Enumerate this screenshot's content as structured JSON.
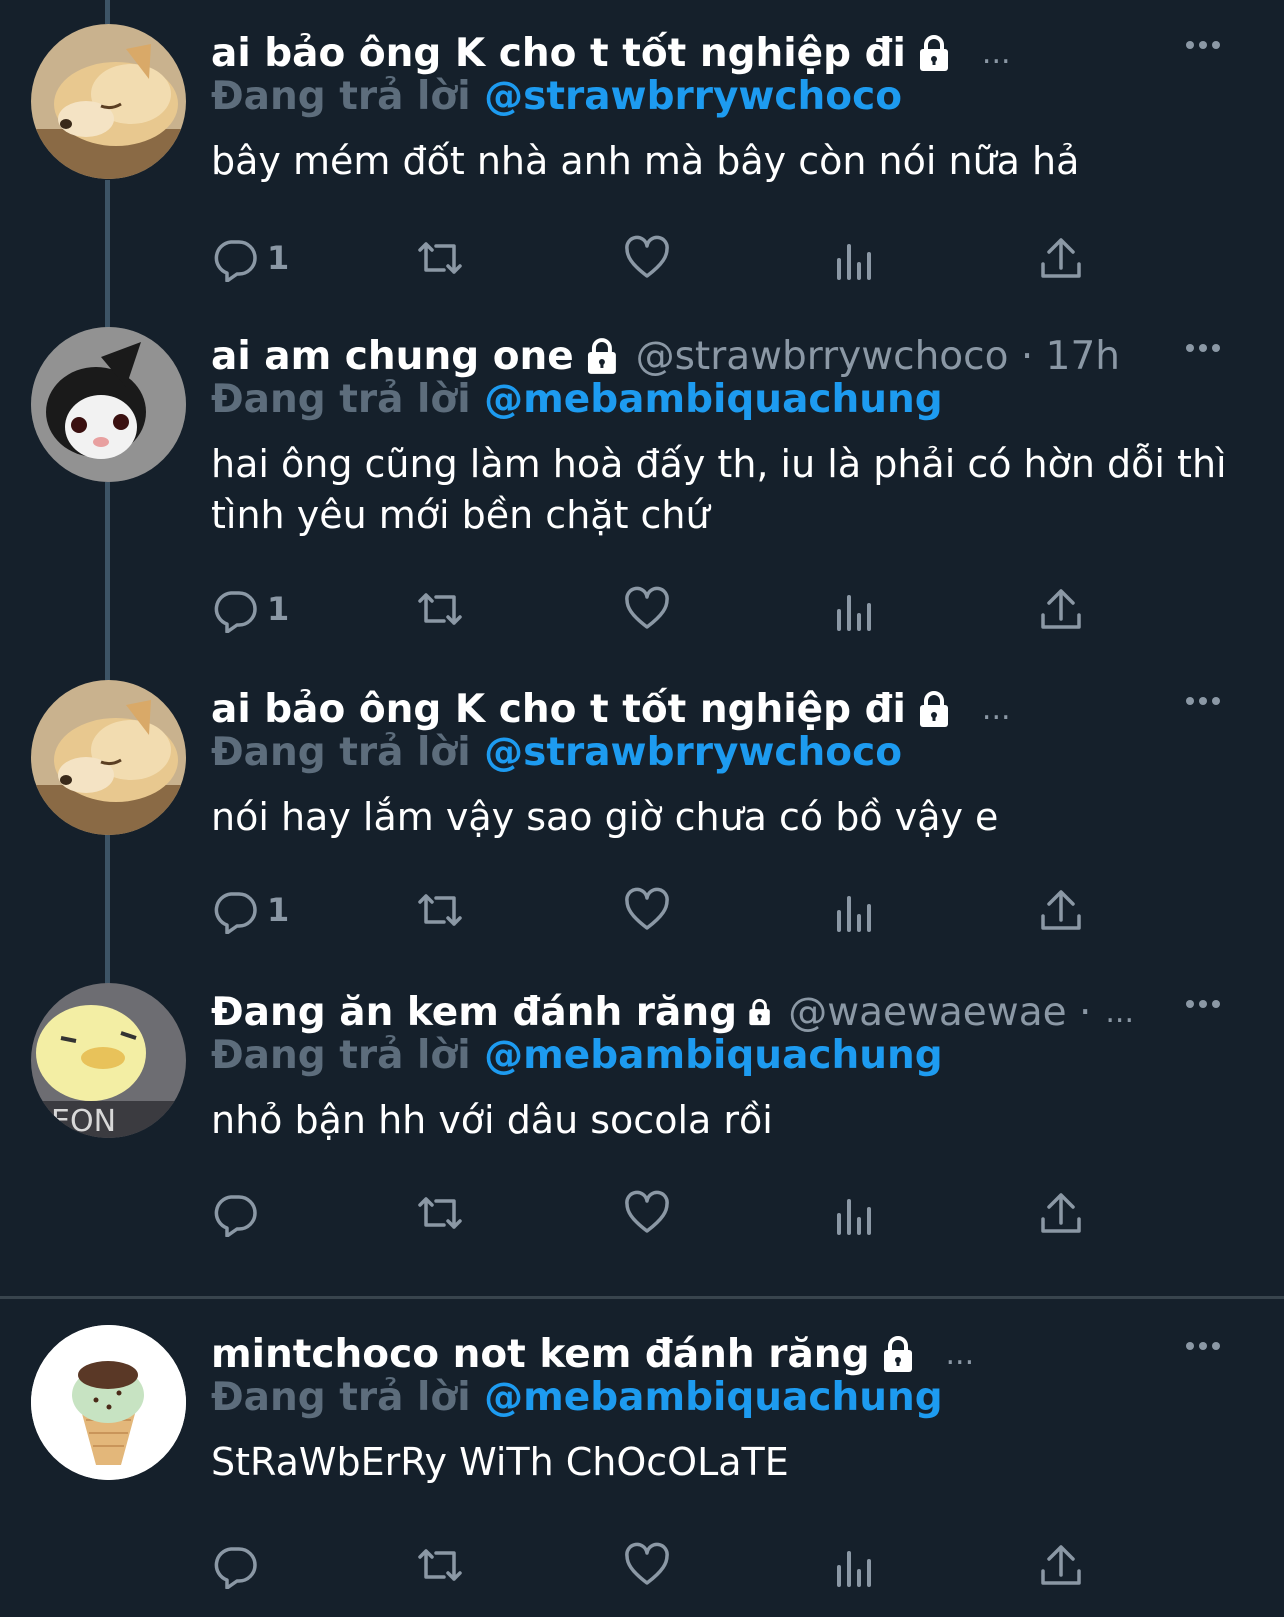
{
  "tweets": [
    {
      "display_name": "ai bảo ông K cho t tốt nghiệp đi",
      "handle": "",
      "trail": "...",
      "reply_prefix": "Đang trả lời",
      "reply_to": "@strawbrrywchoco",
      "text": "bây mém đốt nhà anh mà bây còn nói nữa hả",
      "reply_count": "1",
      "avatar": "dog-avatar"
    },
    {
      "display_name": "ai am chung one",
      "handle": "@strawbrrywchoco · 17h",
      "trail": "",
      "reply_prefix": "Đang trả lời",
      "reply_to": "@mebambiquachung",
      "text": "hai ông cũng làm hoà đấy th, iu là phải có hờn dỗi thì tình yêu mới bền chặt chứ",
      "reply_count": "1",
      "avatar": "cat-avatar"
    },
    {
      "display_name": "ai bảo ông K cho t tốt nghiệp đi",
      "handle": "",
      "trail": "...",
      "reply_prefix": "Đang trả lời",
      "reply_to": "@strawbrrywchoco",
      "text": "nói hay lắm vậy sao giờ chưa có bồ vậy e",
      "reply_count": "1",
      "avatar": "dog-avatar"
    },
    {
      "display_name": "Đang ăn kem đánh răng",
      "handle": "@waewaewae ·",
      "trail": "...",
      "reply_prefix": "Đang trả lời",
      "reply_to": "@mebambiquachung",
      "text": "nhỏ bận hh với dâu socola rồi",
      "reply_count": "",
      "avatar": "duck-avatar"
    },
    {
      "display_name": "mintchoco not kem đánh răng",
      "handle": "",
      "trail": "...",
      "reply_prefix": "Đang trả lời",
      "reply_to": "@mebambiquachung",
      "text": "StRaWbErRy WiTh ChOcOLaTE",
      "reply_count": "",
      "avatar": "icecream-avatar"
    }
  ],
  "icons": {
    "reply": "reply-icon",
    "retweet": "retweet-icon",
    "like": "heart-icon",
    "views": "views-icon",
    "share": "share-icon",
    "more": "more-icon",
    "lock": "lock-icon"
  },
  "colors": {
    "background": "#15202b",
    "accent": "#1d9bf0",
    "muted": "#8b98a5"
  }
}
